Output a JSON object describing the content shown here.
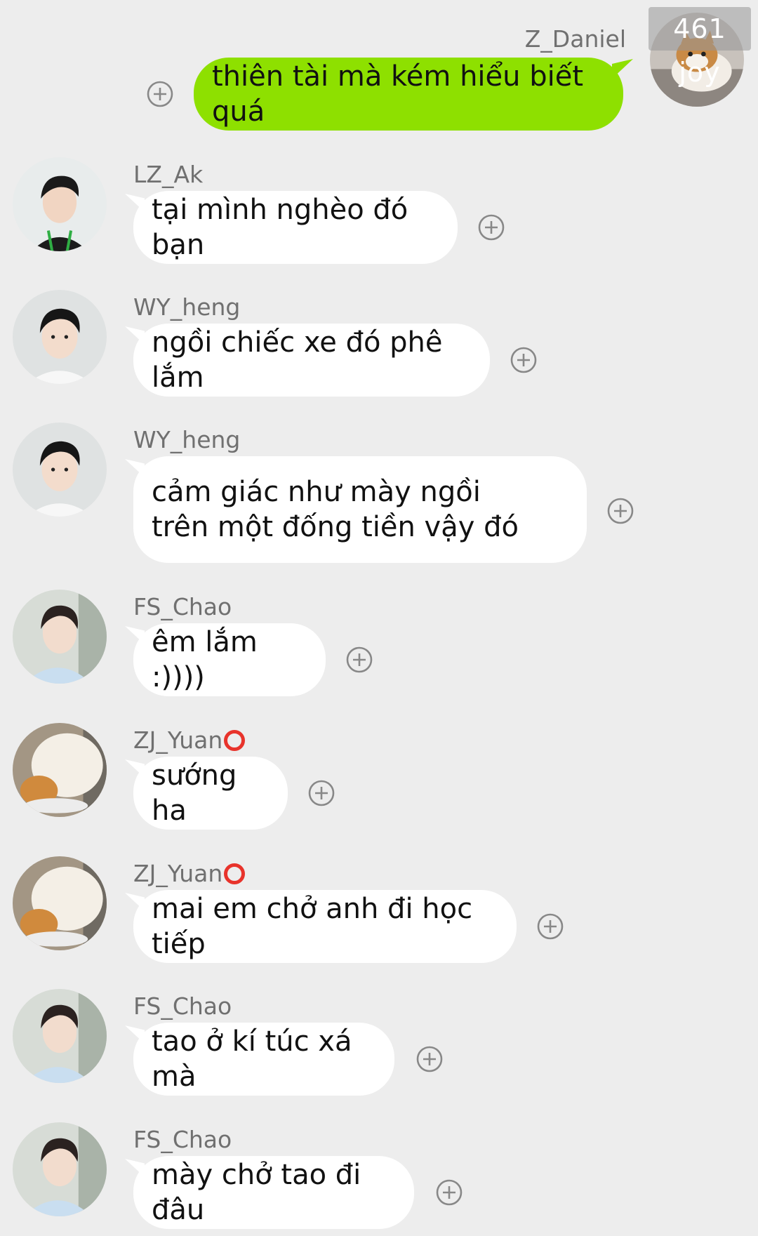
{
  "messages": [
    {
      "sender": "Z_Daniel",
      "text": "thiên tài mà kém hiểu biết quá",
      "direction": "outgoing",
      "avatar": "cat-avatar"
    },
    {
      "sender": "LZ_Ak",
      "text": "tại mình nghèo đó bạn",
      "direction": "incoming",
      "avatar": "person-avatar"
    },
    {
      "sender": "WY_heng",
      "text": "ngồi chiếc xe đó phê lắm",
      "direction": "incoming",
      "avatar": "person-avatar"
    },
    {
      "sender": "WY_heng",
      "text": "cảm giác như mày ngồi trên một đống tiền vậy đó",
      "direction": "incoming",
      "avatar": "person-avatar"
    },
    {
      "sender": "FS_Chao",
      "text": "êm lắm :))))",
      "direction": "incoming",
      "avatar": "person-avatar"
    },
    {
      "sender": "ZJ_Yuan",
      "text": "sướng ha",
      "direction": "incoming",
      "avatar": "cat-avatar"
    },
    {
      "sender": "ZJ_Yuan",
      "text": "mai em chở anh đi học tiếp",
      "direction": "incoming",
      "avatar": "cat-avatar"
    },
    {
      "sender": "FS_Chao",
      "text": "tao ở kí túc xá mà",
      "direction": "incoming",
      "avatar": "person-avatar"
    },
    {
      "sender": "FS_Chao",
      "text": "mày chở tao đi đâu",
      "direction": "incoming",
      "avatar": "person-avatar"
    }
  ],
  "watermark": "461 joy",
  "icons": {
    "add_reaction": "plus-circle-icon",
    "name_badge": "red-ring-icon"
  },
  "colors": {
    "background": "#ededed",
    "outgoing_bubble": "#8ee000",
    "incoming_bubble": "#ffffff",
    "name_text": "#707070",
    "badge_ring": "#e8332b"
  }
}
